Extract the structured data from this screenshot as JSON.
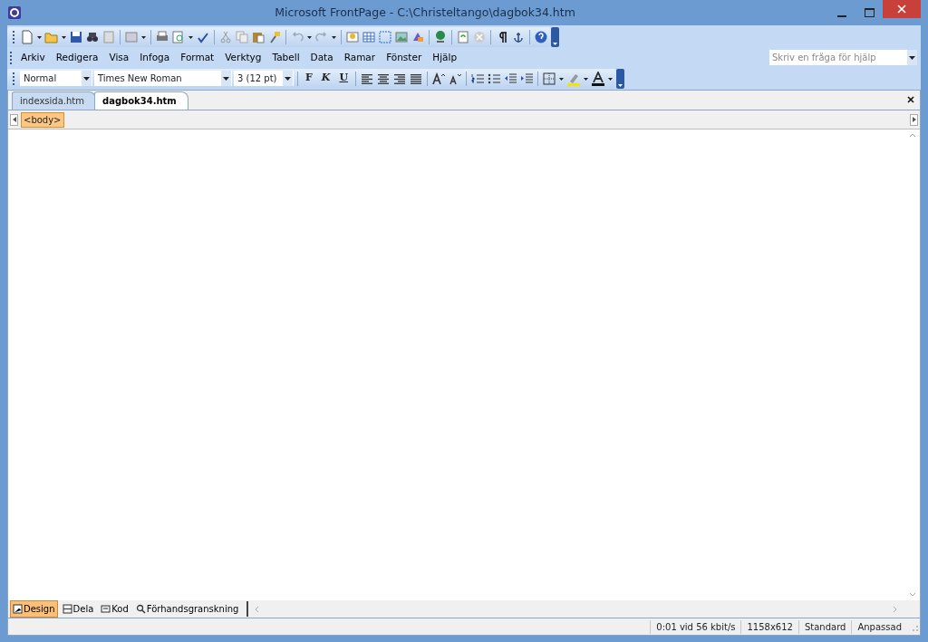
{
  "window": {
    "title": "Microsoft FrontPage - C:\\Christeltango\\dagbok34.htm"
  },
  "menu": [
    {
      "label": "Arkiv"
    },
    {
      "label": "Redigera"
    },
    {
      "label": "Visa"
    },
    {
      "label": "Infoga"
    },
    {
      "label": "Format"
    },
    {
      "label": "Verktyg"
    },
    {
      "label": "Tabell"
    },
    {
      "label": "Data"
    },
    {
      "label": "Ramar"
    },
    {
      "label": "Fönster"
    },
    {
      "label": "Hjälp"
    }
  ],
  "help_search": {
    "placeholder": "Skriv en fråga för hjälp"
  },
  "format_toolbar": {
    "style": "Normal",
    "font": "Times New Roman",
    "size": "3  (12 pt)",
    "buttons": [
      {
        "label": "F",
        "kind": "bold"
      },
      {
        "label": "K",
        "kind": "italic"
      },
      {
        "label": "U",
        "kind": "underline"
      }
    ]
  },
  "document_tabs": [
    {
      "label": "indexsida.htm",
      "selected": false
    },
    {
      "label": "dagbok34.htm",
      "selected": true
    }
  ],
  "tag_selector": [
    "<body>"
  ],
  "view_tabs": [
    {
      "label": "Design",
      "selected": true
    },
    {
      "label": "Dela",
      "selected": false
    },
    {
      "label": "Kod",
      "selected": false
    },
    {
      "label": "Förhandsgranskning",
      "selected": false
    }
  ],
  "status_bar": [
    "0:01 vid 56 kbit/s",
    "1158x612",
    "Standard",
    "Anpassad"
  ]
}
